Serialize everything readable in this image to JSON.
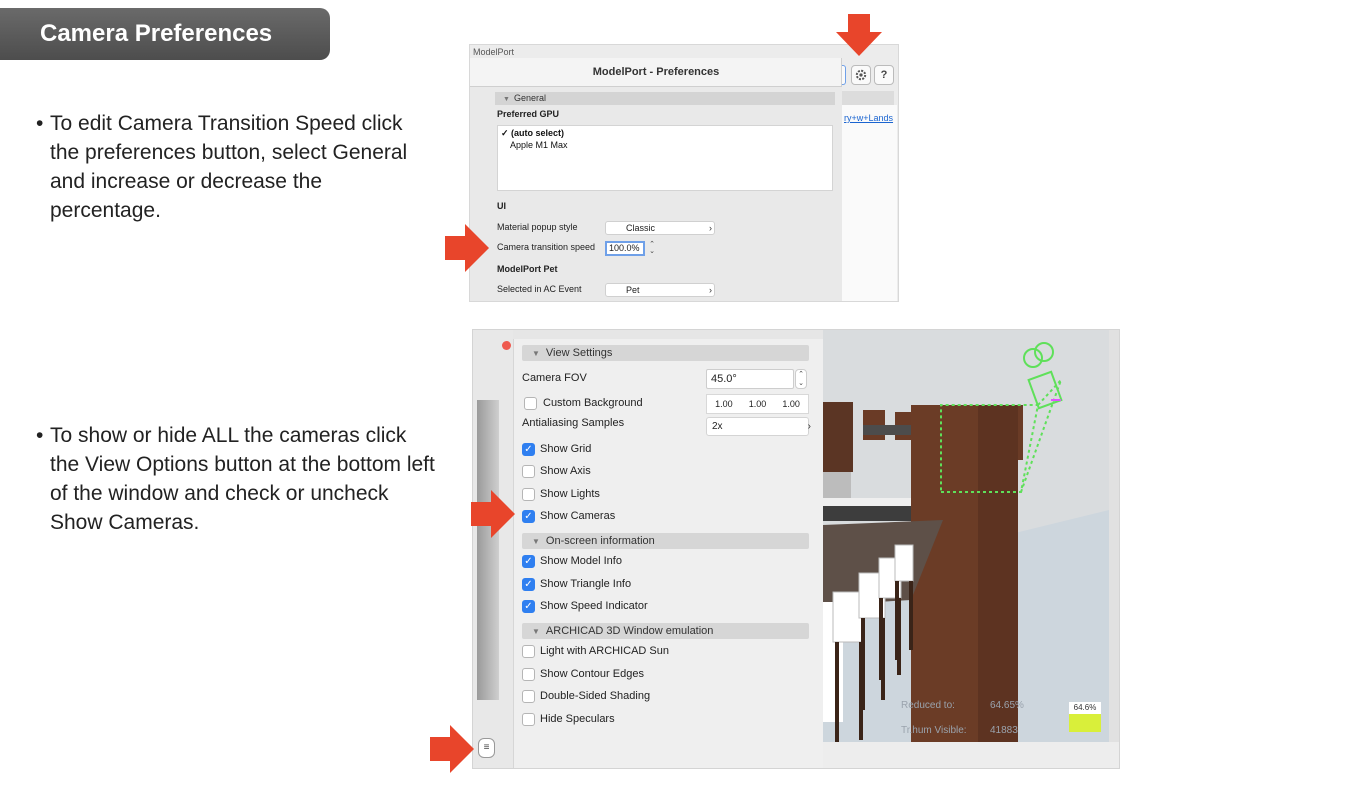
{
  "slide": {
    "title": "Camera Preferences",
    "bullet_char": "•",
    "bullets": [
      "To edit Camera Transition Speed click the preferences button, select General and increase or decrease the percentage.",
      "To show or hide ALL the cameras click the View Options button at the bottom left of the window and check or uncheck Show Cameras."
    ],
    "arrow_color": "#e8452b"
  },
  "preferences": {
    "app_name": "ModelPort",
    "window_title": "ModelPort - Preferences",
    "gear_icon": "gear-icon",
    "help_label": "?",
    "background_link": "ry+w+Lands",
    "section_general": "General",
    "preferred_gpu_label": "Preferred GPU",
    "gpu_options": [
      "✓ (auto select)",
      "Apple M1 Max"
    ],
    "ui_label": "UI",
    "material_popup_label": "Material popup style",
    "material_popup_value": "Classic",
    "camera_speed_label": "Camera transition speed",
    "camera_speed_value": "100.0%",
    "pet_section_label": "ModelPort Pet",
    "selected_event_label": "Selected in AC Event",
    "selected_event_value": "Pet"
  },
  "view_settings": {
    "section_view": "View Settings",
    "camera_fov_label": "Camera FOV",
    "camera_fov_value": "45.0°",
    "custom_background_label": "Custom Background",
    "custom_background_checked": false,
    "background_values": [
      "1.00",
      "1.00",
      "1.00"
    ],
    "antialiasing_label": "Antialiasing Samples",
    "antialiasing_value": "2x",
    "view_checkboxes": [
      {
        "label": "Show Grid",
        "checked": true
      },
      {
        "label": "Show Axis",
        "checked": false
      },
      {
        "label": "Show Lights",
        "checked": false
      },
      {
        "label": "Show Cameras",
        "checked": true
      }
    ],
    "section_onscreen": "On-screen information",
    "onscreen_checkboxes": [
      {
        "label": "Show Model Info",
        "checked": true
      },
      {
        "label": "Show Triangle Info",
        "checked": true
      },
      {
        "label": "Show Speed Indicator",
        "checked": true
      }
    ],
    "section_archicad": "ARCHICAD 3D Window emulation",
    "archicad_checkboxes": [
      {
        "label": "Light with ARCHICAD Sun",
        "checked": false
      },
      {
        "label": "Show Contour Edges",
        "checked": false
      },
      {
        "label": "Double-Sided Shading",
        "checked": false
      },
      {
        "label": "Hide Speculars",
        "checked": false
      }
    ],
    "speed_badge": "64.6%",
    "ghost_reduced_label": "Reduced to:",
    "ghost_reduced_value": "64.65%",
    "ghost_visible_label": "Tr.hum Visible:",
    "ghost_visible_value": "41883",
    "view_options_icon": "menu-icon"
  }
}
